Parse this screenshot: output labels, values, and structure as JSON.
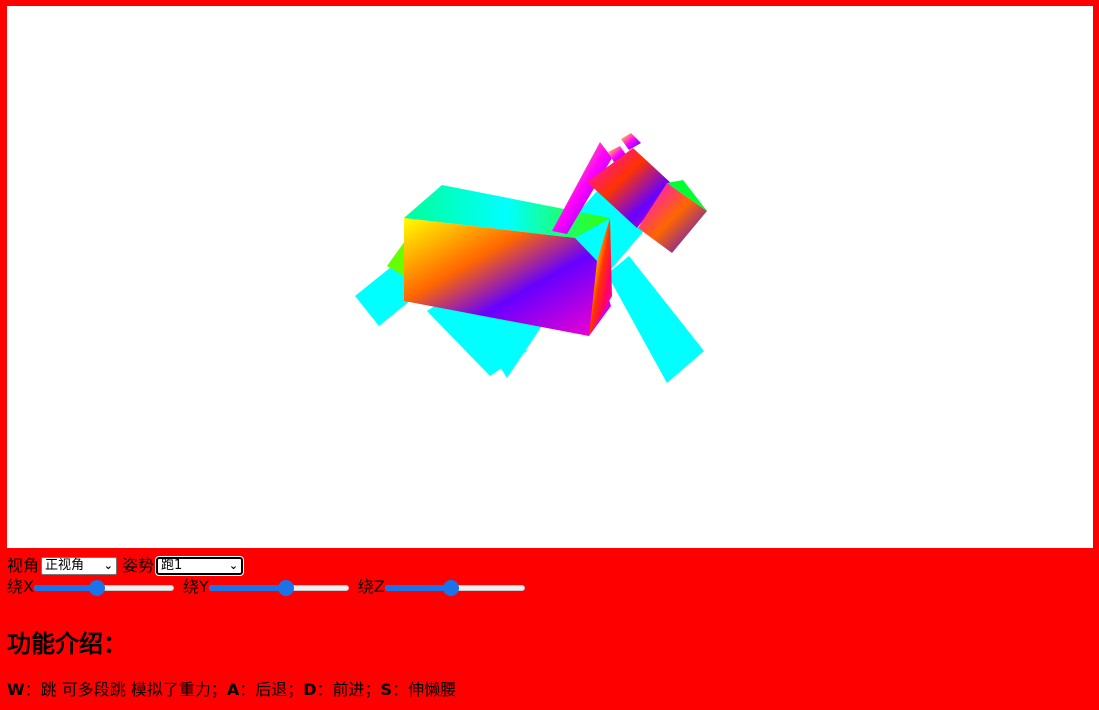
{
  "controls": {
    "view_label": "视角",
    "view_value": "正视角",
    "pose_label": "姿势",
    "pose_value": "跑1",
    "rot_x_label": "绕X",
    "rot_y_label": "绕Y",
    "rot_z_label": "绕Z",
    "rot_x_value": 0.45,
    "rot_y_value": 0.55,
    "rot_z_value": 0.47,
    "slider_color": "#1a73e8"
  },
  "intro": {
    "heading": "功能介绍：",
    "w_key": "W",
    "w_text": "：跳 可多段跳 模拟了重力；",
    "a_key": "A",
    "a_text": "：后退；",
    "d_key": "D",
    "d_text": "：前进；",
    "s_key": "S",
    "s_text": "：伸懒腰"
  },
  "colors": {
    "background": "#ff0000",
    "canvas": "#ffffff",
    "leg": "#00ffff"
  }
}
